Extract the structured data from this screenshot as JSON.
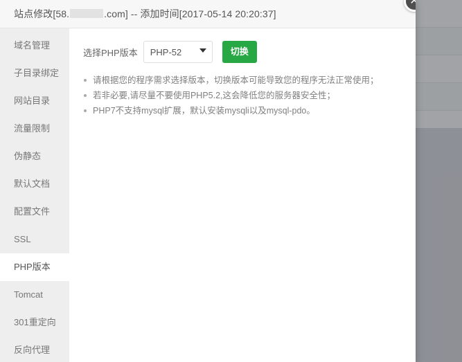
{
  "modal": {
    "title_prefix": "站点修改[58.",
    "title_suffix": ".com] -- 添加时间[2017-05-14 20:20:37]",
    "close_icon": "close-icon",
    "close_glyph": "✕"
  },
  "sidebar": {
    "items": [
      {
        "label": "域名管理",
        "active": false
      },
      {
        "label": "子目录绑定",
        "active": false
      },
      {
        "label": "网站目录",
        "active": false
      },
      {
        "label": "流量限制",
        "active": false
      },
      {
        "label": "伪静态",
        "active": false
      },
      {
        "label": "默认文档",
        "active": false
      },
      {
        "label": "配置文件",
        "active": false
      },
      {
        "label": "SSL",
        "active": false
      },
      {
        "label": "PHP版本",
        "active": true
      },
      {
        "label": "Tomcat",
        "active": false
      },
      {
        "label": "301重定向",
        "active": false
      },
      {
        "label": "反向代理",
        "active": false
      }
    ]
  },
  "content": {
    "php_label": "选择PHP版本",
    "php_selected": "PHP-52",
    "php_options": [
      "PHP-52"
    ],
    "switch_label": "切换",
    "caret_icon": "chevron-down-icon",
    "notes": [
      "请根据您的程序需求选择版本，切换版本可能导致您的程序无法正常使用；",
      "若非必要,请尽量不要使用PHP5.2,这会降低您的服务器安全性；",
      "PHP7不支持mysql扩展，默认安装mysqli以及mysql-pdo。"
    ]
  },
  "colors": {
    "accent_green": "#27a844",
    "sidebar_bg": "#eeeeee",
    "header_bg": "#f7f7f7",
    "overlay": "#9b9ea3"
  }
}
